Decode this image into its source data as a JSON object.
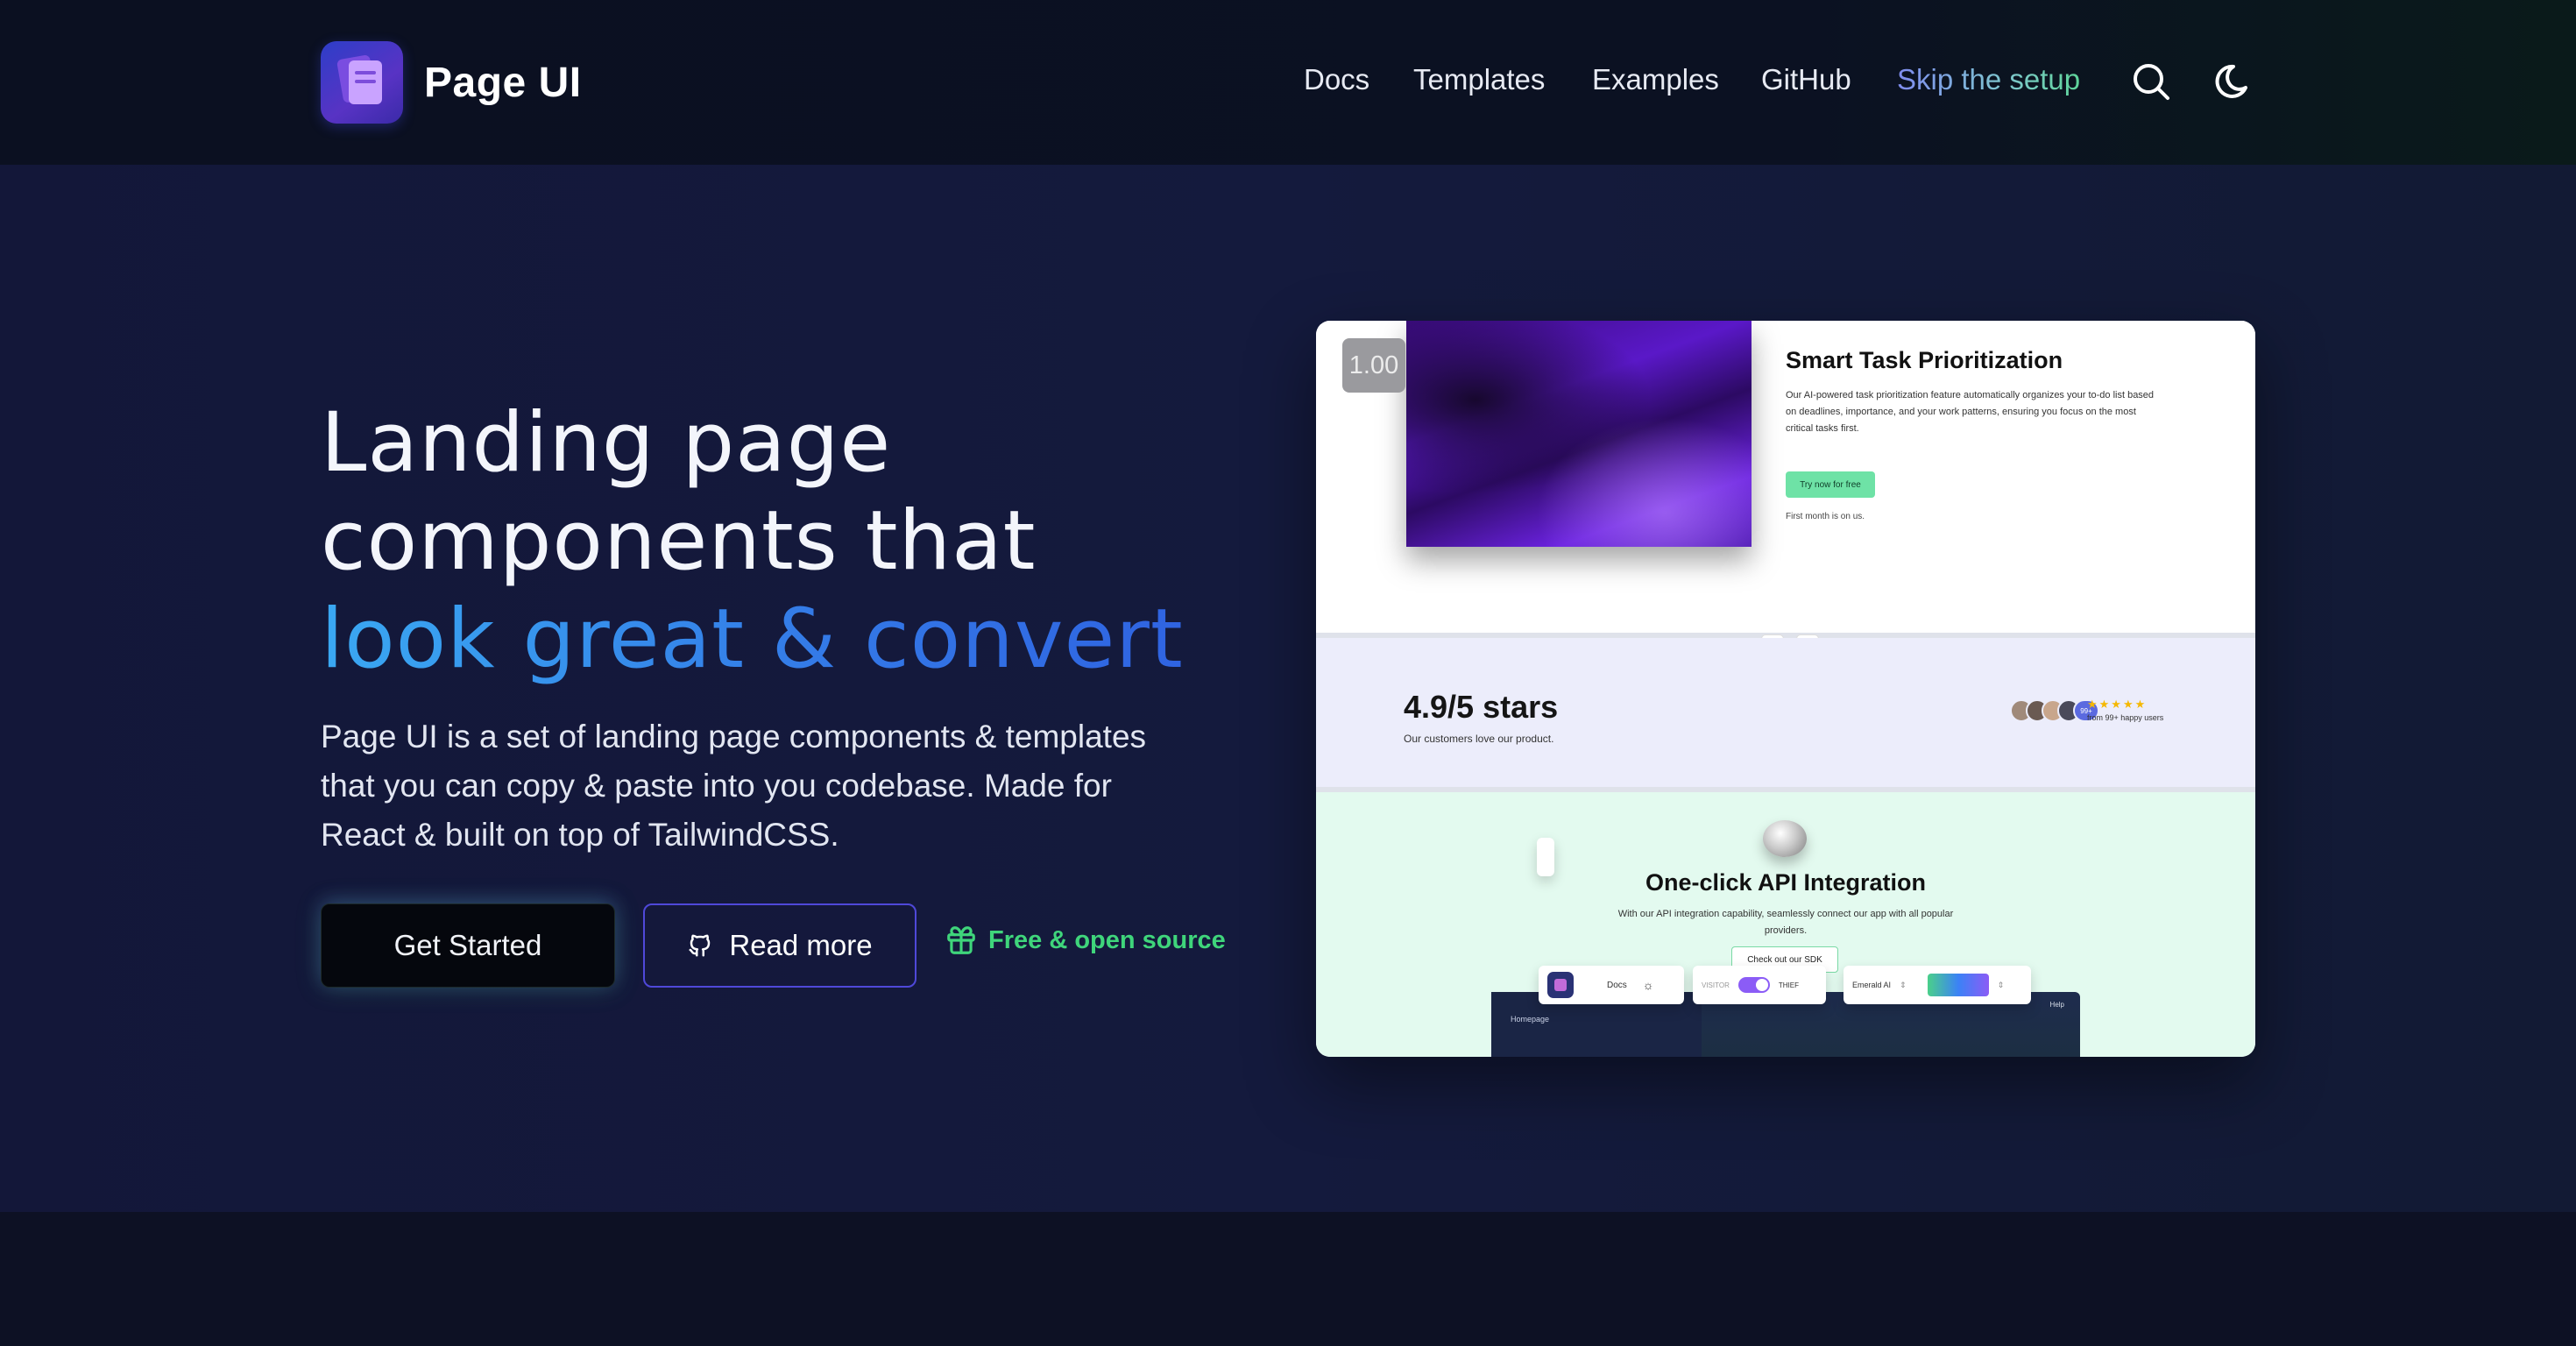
{
  "brand": {
    "name": "Page UI"
  },
  "nav": {
    "items": [
      "Docs",
      "Templates",
      "Examples",
      "GitHub"
    ],
    "highlight": "Skip the setup",
    "icons": [
      "search-icon",
      "moon-icon"
    ]
  },
  "hero": {
    "headline_line1": "Landing page",
    "headline_line2": "components that",
    "headline_line3": "look great & convert",
    "description": "Page UI is a set of landing page components & templates that you can copy & paste into you codebase. Made for React & built on top of TailwindCSS.",
    "primary_button": "Get Started",
    "secondary_button": "Read more",
    "badge": "Free & open source"
  },
  "preview": {
    "zoom": "1.00",
    "section1": {
      "title": "Smart Task Prioritization",
      "description": "Our AI-powered task prioritization feature automatically organizes your to-do list based on deadlines, importance, and your work patterns, ensuring you focus on the most critical tasks first.",
      "button": "Try now for free",
      "note": "First month is on us."
    },
    "section2": {
      "stars": "4.9/5 stars",
      "subtitle": "Our customers love our product.",
      "avatar_count": "99+",
      "rating_text": "from 99+ happy users"
    },
    "section3": {
      "title": "One-click API Integration",
      "description": "With our API integration capability, seamlessly connect our app with all popular providers.",
      "button": "Check out our SDK",
      "app_home": "Homepage",
      "app_help": "Help",
      "pill_docs": "Docs",
      "pill_visitor": "VISITOR",
      "pill_thief": "THIEF",
      "pill_theme": "Emerald AI"
    }
  },
  "colors": {
    "accent_green": "#3fd57b",
    "headline_gradient_start": "#3aa8f2",
    "headline_gradient_end": "#2e5ee0",
    "secondary_border": "#4f48d9"
  }
}
